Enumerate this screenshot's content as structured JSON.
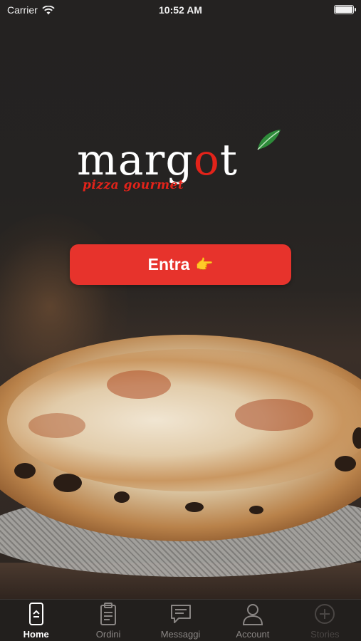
{
  "status_bar": {
    "carrier": "Carrier",
    "time": "10:52 AM",
    "battery_level": 1.0
  },
  "logo": {
    "word_before": "marg",
    "word_o": "o",
    "word_after": "t",
    "subtitle": "pizza gourmet",
    "brand_color": "#e2231a",
    "leaf_color": "#2e8b3a"
  },
  "enter_button": {
    "label": "Entra",
    "icon": "pointing-hand-icon",
    "color": "#e7332c"
  },
  "tab_bar": {
    "tabs": [
      {
        "label": "Home",
        "icon": "home-phone-icon",
        "state": "active"
      },
      {
        "label": "Ordini",
        "icon": "clipboard-icon",
        "state": "normal"
      },
      {
        "label": "Messaggi",
        "icon": "chat-bubble-icon",
        "state": "normal"
      },
      {
        "label": "Account",
        "icon": "user-icon",
        "state": "normal"
      },
      {
        "label": "Stories",
        "icon": "plus-circle-icon",
        "state": "disabled"
      }
    ]
  }
}
